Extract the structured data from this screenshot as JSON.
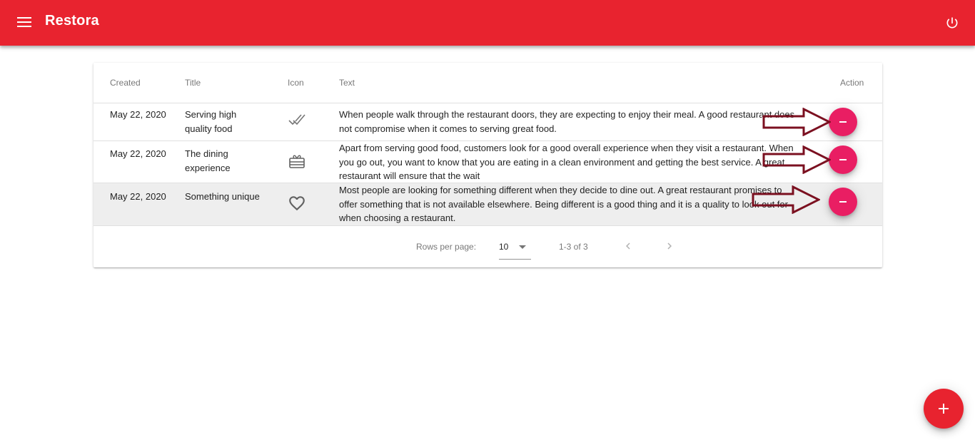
{
  "app": {
    "title": "Restora",
    "primary_color": "#e8232f",
    "accent_color": "#e91e63",
    "menu_icon": "hamburger-menu-icon",
    "power_icon": "power-icon"
  },
  "table": {
    "columns": [
      "Created",
      "Title",
      "Icon",
      "Text",
      "Action"
    ],
    "rows": [
      {
        "created": "May 22, 2020",
        "title": "Serving high quality food",
        "icon": "double-check-icon",
        "text": "When people walk through the restaurant doors, they are expecting to enjoy their meal. A good restaurant does not compromise when it comes to serving great food.",
        "action_icon": "remove-icon"
      },
      {
        "created": "May 22, 2020",
        "title": "The dining experience",
        "icon": "gift-card-icon",
        "text": "Apart from serving good food, customers look for a good overall experience when they visit a restaurant. When you go out, you want to know that you are eating in a clean environment and getting the best service. A great restaurant will ensure that the wait",
        "action_icon": "remove-icon"
      },
      {
        "created": "May 22, 2020",
        "title": "Something unique",
        "icon": "heart-outline-icon",
        "text": "Most people are looking for something different when they decide to dine out. A great restaurant promises to offer something that is not available elsewhere. Being different is a good thing and it is a quality to look out for when choosing a restaurant.",
        "action_icon": "remove-icon",
        "selected": true
      }
    ],
    "pagination": {
      "rows_per_page_label": "Rows per page:",
      "rows_per_page_value": "10",
      "range_label": "1-3 of 3",
      "prev_icon": "chevron-left-icon",
      "next_icon": "chevron-right-icon"
    }
  },
  "fab": {
    "icon": "add-icon"
  },
  "annotation": {
    "arrow_color": "#7b1020"
  }
}
